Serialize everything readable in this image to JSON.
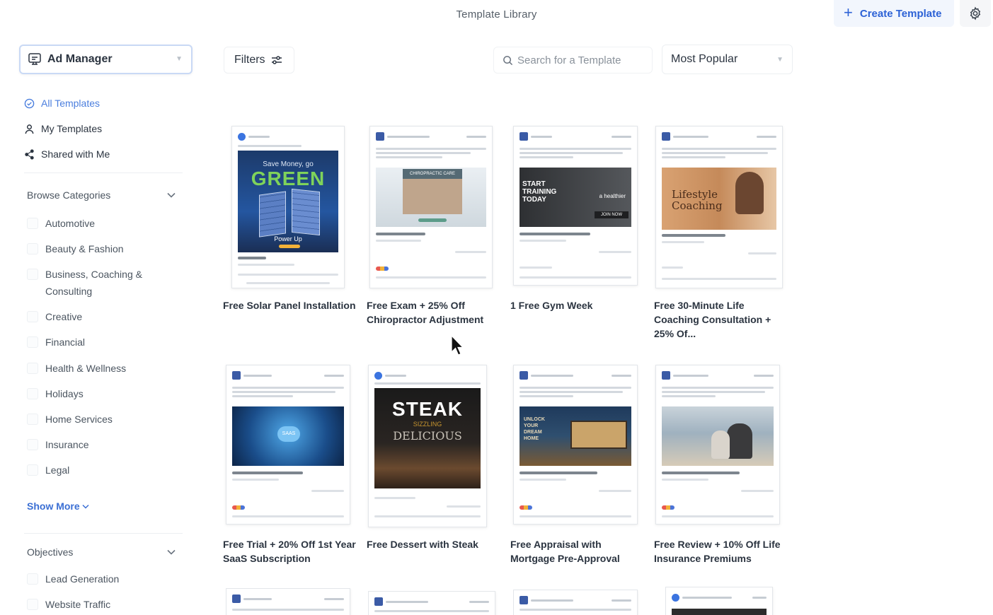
{
  "header": {
    "title": "Template Library",
    "create_label": "Create Template"
  },
  "sidebar": {
    "account": "Ad Manager",
    "nav": [
      "All Templates",
      "My Templates",
      "Shared with Me"
    ],
    "browse_title": "Browse Categories",
    "categories": [
      "Automotive",
      "Beauty & Fashion",
      "Business, Coaching &",
      "Consulting",
      "Creative",
      "Financial",
      "Health & Wellness",
      "Holidays",
      "Home Services",
      "Insurance",
      "Legal"
    ],
    "show_more": "Show More",
    "objectives_title": "Objectives",
    "objectives": [
      "Lead Generation",
      "Website Traffic"
    ]
  },
  "toolbar": {
    "filters_label": "Filters",
    "search_placeholder": "Search for a Template",
    "sort_value": "Most Popular"
  },
  "thumb_text": {
    "solar_1": "Save Money, go",
    "solar_2": "GREEN",
    "solar_3": "Power Up",
    "chiro": "CHIROPRACTIC CARE",
    "gym_1": "START",
    "gym_2": "TRAINING",
    "gym_3": "TODAY",
    "gym_4": "a healthier",
    "gym_5": "JOIN NOW",
    "life_1": "Lifestyle",
    "life_2": "Coaching",
    "saas": "SAAS",
    "steak_1": "STEAK",
    "steak_2": "SIZZLING",
    "steak_3": "DELICIOUS",
    "mortgage": "UNLOCK YOUR DREAM HOME"
  },
  "templates": [
    {
      "title": "Free Solar Panel Installation"
    },
    {
      "title": "Free Exam + 25% Off Chiropractor Adjustment"
    },
    {
      "title": "1 Free Gym Week"
    },
    {
      "title": "Free 30-Minute Life Coaching Consultation + 25% Of..."
    },
    {
      "title": "Free Trial + 20% Off 1st Year SaaS Subscription"
    },
    {
      "title": "Free Dessert with Steak"
    },
    {
      "title": "Free Appraisal with Mortgage Pre-Approval"
    },
    {
      "title": "Free Review + 10% Off Life Insurance Premiums"
    }
  ],
  "colors": {
    "accent": "#2d62d6",
    "active_nav": "#4a7ede"
  }
}
